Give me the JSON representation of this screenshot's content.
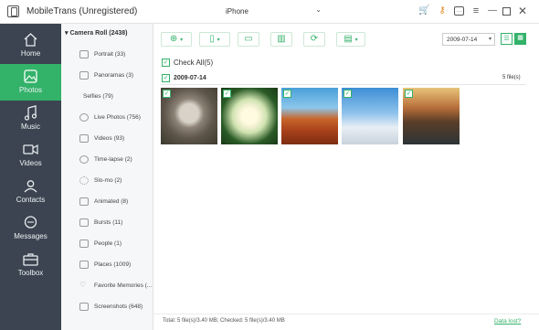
{
  "app": {
    "title": "MobileTrans (Unregistered)",
    "device": "iPhone"
  },
  "colors": {
    "accent": "#33b269",
    "nav_bg": "#3b4450"
  },
  "nav": {
    "items": [
      {
        "label": "Home",
        "icon": "home-icon"
      },
      {
        "label": "Photos",
        "icon": "photo-icon",
        "active": true
      },
      {
        "label": "Music",
        "icon": "music-icon"
      },
      {
        "label": "Videos",
        "icon": "video-icon"
      },
      {
        "label": "Contacts",
        "icon": "contacts-icon"
      },
      {
        "label": "Messages",
        "icon": "messages-icon"
      },
      {
        "label": "Toolbox",
        "icon": "toolbox-icon"
      }
    ]
  },
  "sidebar": {
    "header": "Camera Roll (2438)",
    "items": [
      {
        "label": "Portrait (33)"
      },
      {
        "label": "Panoramas (3)"
      },
      {
        "label": "Selfies (79)"
      },
      {
        "label": "Live Photos (756)"
      },
      {
        "label": "Videos (93)"
      },
      {
        "label": "Time-lapse (2)"
      },
      {
        "label": "Slo-mo (2)"
      },
      {
        "label": "Animated (8)"
      },
      {
        "label": "Bursts (11)"
      },
      {
        "label": "People (1)"
      },
      {
        "label": "Places (1009)"
      },
      {
        "label": "Favorite Memories (..."
      },
      {
        "label": "Screenshots (648)"
      }
    ]
  },
  "toolbar": {
    "date_filter": "2009-07-14"
  },
  "content": {
    "check_all_label": "Check All(5)",
    "group_date": "2009-07-14",
    "group_count": "5 file(s)",
    "photos": [
      {
        "name": "koala"
      },
      {
        "name": "white-flower"
      },
      {
        "name": "desert-canyon"
      },
      {
        "name": "penguins"
      },
      {
        "name": "lighthouse"
      }
    ]
  },
  "status": {
    "summary": "Total: 5 file(s)/3.40 MB; Checked: 5 file(s)/3.40 MB",
    "help_link": "Data lost?"
  }
}
